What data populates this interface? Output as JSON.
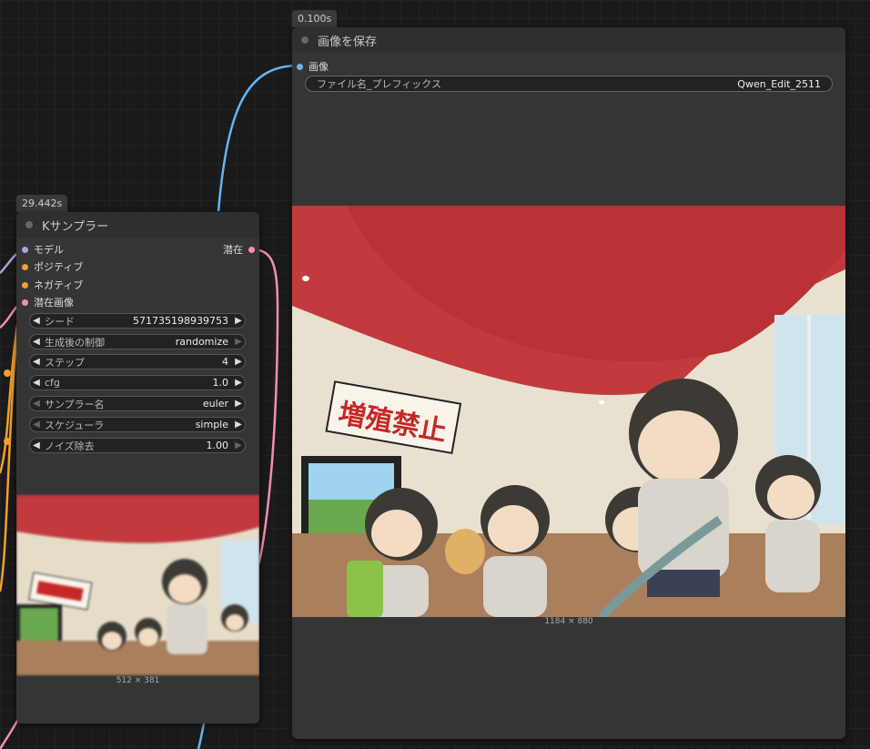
{
  "ksampler": {
    "timing": "29.442s",
    "title": "Kサンプラー",
    "inputs": [
      {
        "label": "モデル",
        "color": "#b39ddb"
      },
      {
        "label": "ポジティブ",
        "color": "#f0a030"
      },
      {
        "label": "ネガティブ",
        "color": "#f0a030"
      },
      {
        "label": "潜在画像",
        "color": "#f48fb1"
      }
    ],
    "output": {
      "label": "潜在",
      "color": "#f48fb1"
    },
    "widgets": [
      {
        "label": "シード",
        "value": "571735198939753",
        "left_dim": false,
        "right_dim": false
      },
      {
        "label": "生成後の制御",
        "value": "randomize",
        "left_dim": false,
        "right_dim": true
      },
      {
        "label": "ステップ",
        "value": "4",
        "left_dim": false,
        "right_dim": false
      },
      {
        "label": "cfg",
        "value": "1.0",
        "left_dim": false,
        "right_dim": false
      },
      {
        "label": "サンプラー名",
        "value": "euler",
        "left_dim": true,
        "right_dim": false
      },
      {
        "label": "スケジューラ",
        "value": "simple",
        "left_dim": true,
        "right_dim": false
      },
      {
        "label": "ノイズ除去",
        "value": "1.00",
        "left_dim": false,
        "right_dim": true
      }
    ],
    "preview_dims": "512 × 381"
  },
  "save_image": {
    "timing": "0.100s",
    "title": "画像を保存",
    "input": {
      "label": "画像",
      "color": "#64b5f6"
    },
    "filename_prefix": {
      "label": "ファイル名_プレフィックス",
      "value": "Qwen_Edit_2511"
    },
    "preview_dims": "1184 × 880",
    "sign_text": "増殖禁止"
  },
  "colors": {
    "wire_orange": "#f0a030",
    "wire_pink": "#f48fb1",
    "wire_blue": "#64b5f6",
    "wire_purple": "#b39ddb"
  }
}
